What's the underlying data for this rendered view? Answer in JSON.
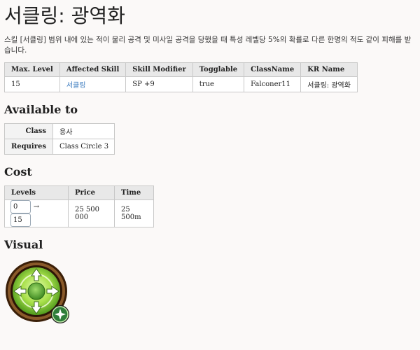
{
  "page": {
    "title": "서클링: 광역화",
    "description": "스킬 [서클링] 범위 내에 있는 적이 물리 공격 및 미사일 공격을 당했을 때 특성 레벨당 5%의 확률로 다른 한명의 적도 같이 피해를 받습니다."
  },
  "properties": {
    "headers": [
      "Max. Level",
      "Affected Skill",
      "Skill Modifier",
      "Togglable",
      "ClassName",
      "KR Name"
    ],
    "row": {
      "max_level": "15",
      "affected_skill": "서클링",
      "skill_modifier": "SP +9",
      "togglable": "true",
      "class_name": "Falconer11",
      "kr_name": "서클링: 광역화"
    }
  },
  "available_to": {
    "heading": "Available to",
    "class_label": "Class",
    "class_value": "응사",
    "requires_label": "Requires",
    "requires_value": "Class Circle 3"
  },
  "cost": {
    "heading": "Cost",
    "headers": [
      "Levels",
      "Price",
      "Time"
    ],
    "level_from": "0",
    "level_to": "15",
    "arrow": "→",
    "price": "25 500 000",
    "time": "25 500m"
  },
  "visual": {
    "heading": "Visual",
    "icon": "circling-expansion-skill-icon"
  },
  "colors": {
    "link": "#3b7bbf",
    "icon_ring": "#6b3d16",
    "icon_green": "#8fd63a",
    "badge": "#2e7d3a"
  }
}
